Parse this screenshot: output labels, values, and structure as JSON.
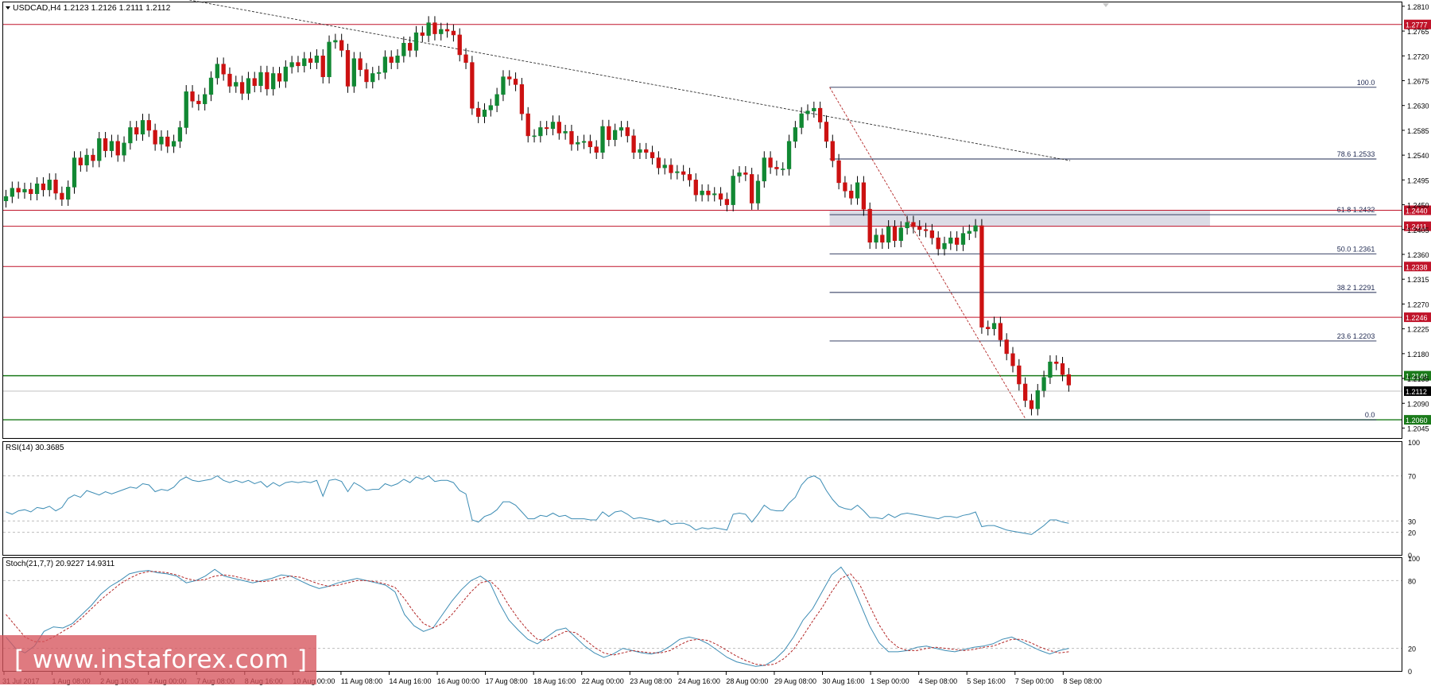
{
  "header": {
    "symbol_line": "USDCAD,H4  1.2123 1.2126 1.2111 1.2112"
  },
  "indicators": {
    "rsi_label": "RSI(14) 30.3685",
    "stoch_label": "Stoch(21,7,7) 20.9227 14.9311"
  },
  "watermark": "[ www.instaforex.com ]",
  "colors": {
    "bull_candle": "#118833",
    "bear_candle": "#cc1111",
    "resistance_line": "#c0142a",
    "support_line": "#1a7a1a",
    "indicator_line": "#3c8cb4",
    "signal_line": "#b42828",
    "fib_line": "#1e2850"
  },
  "chart_data": {
    "type": "candlestick",
    "symbol": "USDCAD",
    "timeframe": "H4",
    "ylim": [
      1.2027,
      1.2817
    ],
    "y_ticks": [
      "1.2810",
      "1.2765",
      "1.2720",
      "1.2675",
      "1.2630",
      "1.2585",
      "1.2540",
      "1.2495",
      "1.2450",
      "1.2405",
      "1.2360",
      "1.2315",
      "1.2270",
      "1.2225",
      "1.2180",
      "1.2135",
      "1.2090",
      "1.2045"
    ],
    "x_ticks": [
      "31 Jul 2017",
      "1 Aug 08:00",
      "2 Aug 16:00",
      "4 Aug 00:00",
      "7 Aug 08:00",
      "8 Aug 16:00",
      "10 Aug 00:00",
      "11 Aug 08:00",
      "14 Aug 16:00",
      "16 Aug 00:00",
      "17 Aug 08:00",
      "18 Aug 16:00",
      "22 Aug 00:00",
      "23 Aug 08:00",
      "24 Aug 16:00",
      "28 Aug 00:00",
      "29 Aug 08:00",
      "30 Aug 16:00",
      "1 Sep 00:00",
      "4 Sep 08:00",
      "5 Sep 16:00",
      "7 Sep 00:00",
      "8 Sep 08:00"
    ],
    "price_levels": [
      {
        "label": "1.2777",
        "value": 1.2777,
        "kind": "resistance"
      },
      {
        "label": "1.2440",
        "value": 1.244,
        "kind": "resistance"
      },
      {
        "label": "1.2411",
        "value": 1.2411,
        "kind": "resistance"
      },
      {
        "label": "1.2338",
        "value": 1.2338,
        "kind": "resistance"
      },
      {
        "label": "1.2246",
        "value": 1.2246,
        "kind": "resistance"
      },
      {
        "label": "1.2140",
        "value": 1.214,
        "kind": "support"
      },
      {
        "label": "1.2060",
        "value": 1.206,
        "kind": "support"
      }
    ],
    "current_price": {
      "label": "1.2112",
      "value": 1.2112
    },
    "fibonacci": [
      {
        "label": "100.0",
        "value": 1.2663
      },
      {
        "label": "78.6 1.2533",
        "value": 1.2533
      },
      {
        "label": "61.8 1.2432",
        "value": 1.2432
      },
      {
        "label": "50.0 1.2361",
        "value": 1.2361
      },
      {
        "label": "38.2 1.2291",
        "value": 1.2291
      },
      {
        "label": "23.6 1.2203",
        "value": 1.2203
      },
      {
        "label": "0.0",
        "value": 1.206
      }
    ],
    "zone": {
      "low": 1.2411,
      "high": 1.244
    },
    "trendline": {
      "from": [
        0.108,
        1.2833
      ],
      "to": [
        0.763,
        1.253
      ]
    },
    "swing_line": {
      "from": [
        0.591,
        1.2663
      ],
      "to": [
        0.731,
        1.2062
      ]
    },
    "candles_close": [
      1.2465,
      1.248,
      1.2473,
      1.2478,
      1.247,
      1.2488,
      1.2477,
      1.2495,
      1.2471,
      1.246,
      1.2482,
      1.2535,
      1.2522,
      1.254,
      1.253,
      1.257,
      1.2548,
      1.2565,
      1.254,
      1.2562,
      1.259,
      1.2578,
      1.2603,
      1.2585,
      1.256,
      1.2573,
      1.2556,
      1.2565,
      1.259,
      1.2655,
      1.2638,
      1.2633,
      1.265,
      1.268,
      1.2705,
      1.2687,
      1.2665,
      1.2672,
      1.2652,
      1.2679,
      1.2666,
      1.269,
      1.266,
      1.2688,
      1.2674,
      1.27,
      1.2708,
      1.2702,
      1.2715,
      1.2708,
      1.272,
      1.2682,
      1.2745,
      1.2748,
      1.273,
      1.2665,
      1.2715,
      1.2695,
      1.2673,
      1.2688,
      1.269,
      1.2718,
      1.2708,
      1.272,
      1.2743,
      1.273,
      1.2762,
      1.2757,
      1.278,
      1.276,
      1.2768,
      1.2765,
      1.2758,
      1.2722,
      1.2708,
      1.2625,
      1.261,
      1.2622,
      1.263,
      1.265,
      1.2682,
      1.2678,
      1.2668,
      1.2615,
      1.2575,
      1.2575,
      1.259,
      1.2588,
      1.26,
      1.258,
      1.2583,
      1.256,
      1.2563,
      1.2565,
      1.2555,
      1.2545,
      1.2592,
      1.2568,
      1.2585,
      1.259,
      1.2575,
      1.2545,
      1.255,
      1.2545,
      1.2535,
      1.2517,
      1.2522,
      1.2508,
      1.251,
      1.2505,
      1.2495,
      1.2468,
      1.2475,
      1.2468,
      1.247,
      1.246,
      1.245,
      1.2502,
      1.2508,
      1.2505,
      1.2453,
      1.2493,
      1.2535,
      1.2518,
      1.2515,
      1.2515,
      1.2565,
      1.259,
      1.2615,
      1.262,
      1.2625,
      1.26,
      1.2565,
      1.253,
      1.249,
      1.2475,
      1.2462,
      1.249,
      1.2442,
      1.2382,
      1.2395,
      1.2382,
      1.241,
      1.2385,
      1.2408,
      1.2418,
      1.241,
      1.2405,
      1.2403,
      1.239,
      1.237,
      1.238,
      1.239,
      1.2378,
      1.2398,
      1.2402,
      1.2412,
      1.2228,
      1.2225,
      1.2235,
      1.2205,
      1.218,
      1.2158,
      1.2125,
      1.2095,
      1.208,
      1.2113,
      1.2137,
      1.2165,
      1.2162,
      1.2142,
      1.2123
    ],
    "series": [
      {
        "name": "RSI(14)",
        "pane": "rsi",
        "ylim": [
          0,
          100
        ],
        "ticks": [
          100,
          70,
          30,
          20,
          0
        ],
        "values": [
          38,
          36,
          39,
          40,
          38,
          42,
          41,
          43,
          39,
          42,
          50,
          53,
          51,
          57,
          55,
          53,
          56,
          54,
          56,
          58,
          60,
          59,
          63,
          62,
          56,
          58,
          57,
          60,
          66,
          69,
          66,
          65,
          66,
          67,
          70,
          66,
          64,
          66,
          64,
          66,
          63,
          65,
          60,
          64,
          61,
          64,
          65,
          64,
          65,
          64,
          66,
          52,
          66,
          67,
          65,
          56,
          64,
          61,
          57,
          58,
          58,
          63,
          61,
          63,
          67,
          64,
          69,
          67,
          70,
          65,
          66,
          66,
          64,
          57,
          54,
          31,
          29,
          34,
          36,
          40,
          47,
          47,
          44,
          38,
          32,
          32,
          35,
          34,
          37,
          34,
          35,
          32,
          32,
          32,
          31,
          31,
          38,
          34,
          38,
          39,
          36,
          32,
          33,
          32,
          31,
          29,
          31,
          27,
          28,
          28,
          26,
          22,
          24,
          23,
          24,
          23,
          22,
          36,
          37,
          36,
          29,
          36,
          44,
          40,
          39,
          39,
          46,
          51,
          62,
          68,
          70,
          67,
          57,
          49,
          43,
          41,
          40,
          44,
          39,
          33,
          33,
          32,
          36,
          33,
          36,
          37,
          36,
          35,
          34,
          33,
          32,
          34,
          34,
          33,
          35,
          36,
          38,
          25,
          26,
          26,
          24,
          22,
          21,
          20,
          19,
          18,
          22,
          26,
          31,
          31,
          29,
          28
        ]
      },
      {
        "name": "Stoch main",
        "pane": "stoch",
        "ylim": [
          0,
          100
        ],
        "ticks": [
          100,
          80,
          20,
          0
        ],
        "values": [
          30,
          20,
          16,
          22,
          35,
          39,
          38,
          42,
          50,
          58,
          68,
          75,
          80,
          86,
          88,
          89,
          87,
          86,
          84,
          78,
          80,
          84,
          90,
          84,
          82,
          80,
          78,
          80,
          82,
          85,
          84,
          80,
          76,
          73,
          75,
          78,
          80,
          82,
          80,
          78,
          76,
          70,
          50,
          40,
          35,
          38,
          50,
          62,
          72,
          80,
          84,
          78,
          60,
          45,
          36,
          28,
          24,
          30,
          36,
          38,
          30,
          22,
          16,
          12,
          15,
          20,
          18,
          16,
          15,
          17,
          22,
          28,
          30,
          28,
          24,
          18,
          12,
          8,
          6,
          4,
          5,
          10,
          18,
          30,
          45,
          55,
          70,
          85,
          92,
          80,
          60,
          40,
          25,
          17,
          17,
          18,
          21,
          22,
          20,
          18,
          17,
          19,
          21,
          22,
          24,
          28,
          30,
          26,
          22,
          18,
          15,
          18,
          20
        ]
      },
      {
        "name": "Stoch signal",
        "pane": "stoch",
        "ylim": [
          0,
          100
        ],
        "values": [
          50,
          40,
          30,
          26,
          26,
          30,
          35,
          40,
          47,
          55,
          63,
          70,
          77,
          82,
          86,
          88,
          88,
          87,
          85,
          82,
          80,
          81,
          84,
          85,
          84,
          82,
          80,
          79,
          80,
          82,
          84,
          83,
          80,
          77,
          75,
          76,
          78,
          80,
          80,
          79,
          77,
          74,
          64,
          52,
          42,
          38,
          42,
          50,
          60,
          70,
          78,
          80,
          72,
          58,
          46,
          36,
          28,
          27,
          31,
          35,
          34,
          28,
          21,
          16,
          14,
          16,
          18,
          17,
          16,
          16,
          18,
          23,
          27,
          28,
          27,
          23,
          18,
          13,
          9,
          6,
          5,
          6,
          11,
          19,
          31,
          44,
          56,
          70,
          82,
          86,
          76,
          58,
          41,
          28,
          21,
          18,
          18,
          20,
          21,
          20,
          19,
          18,
          19,
          21,
          22,
          25,
          28,
          28,
          25,
          21,
          18,
          16,
          17
        ]
      }
    ]
  }
}
